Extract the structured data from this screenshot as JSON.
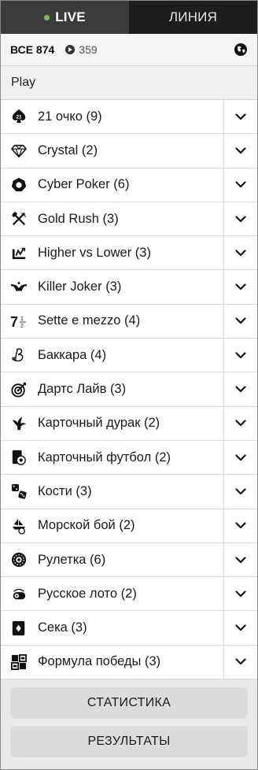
{
  "tabs": {
    "live_label": "LIVE",
    "line_label": "ЛИНИЯ"
  },
  "filter": {
    "all_label": "ВСЕ 874",
    "live_count": "359"
  },
  "section": {
    "title": "Play"
  },
  "items": [
    {
      "label": "21 очко (9)",
      "icon": "blackjack-21-icon"
    },
    {
      "label": "Crystal (2)",
      "icon": "diamond-icon"
    },
    {
      "label": "Cyber Poker (6)",
      "icon": "poker-chip-icon"
    },
    {
      "label": "Gold Rush (3)",
      "icon": "pickaxe-hammer-icon"
    },
    {
      "label": "Higher vs Lower (3)",
      "icon": "higher-lower-icon"
    },
    {
      "label": "Killer Joker (3)",
      "icon": "joker-hat-icon"
    },
    {
      "label": "Sette e mezzo (4)",
      "icon": "seven-half-icon"
    },
    {
      "label": "Баккара (4)",
      "icon": "baccarat-b-icon"
    },
    {
      "label": "Дартс Лайв (3)",
      "icon": "darts-icon"
    },
    {
      "label": "Карточный дурак (2)",
      "icon": "jester-icon"
    },
    {
      "label": "Карточный футбол (2)",
      "icon": "card-football-icon"
    },
    {
      "label": "Кости (3)",
      "icon": "dice-icon"
    },
    {
      "label": "Морской бой (2)",
      "icon": "sea-battle-icon"
    },
    {
      "label": "Рулетка (6)",
      "icon": "roulette-icon"
    },
    {
      "label": "Русское лото (2)",
      "icon": "lotto-icon"
    },
    {
      "label": "Сека (3)",
      "icon": "card-icon"
    },
    {
      "label": "Формула победы (3)",
      "icon": "formula-icon"
    }
  ],
  "buttons": {
    "statistics": "СТАТИСТИКА",
    "results": "РЕЗУЛЬТАТЫ"
  },
  "colors": {
    "live_dot": "#7cc143",
    "tab_live_bg": "#3b3b3b",
    "tab_line_bg": "#1d1d1d"
  }
}
